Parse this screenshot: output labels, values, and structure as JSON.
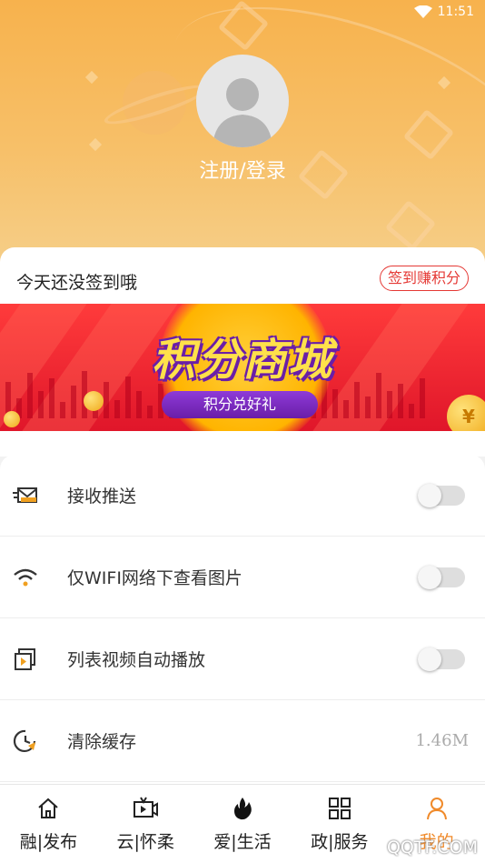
{
  "status_bar": {
    "time": "11:51"
  },
  "profile": {
    "login_label": "注册/登录"
  },
  "signin": {
    "prompt": "今天还没签到哦",
    "button_label": "签到赚积分"
  },
  "banner": {
    "title": "积分商城",
    "subtitle": "积分兑好礼",
    "coin_symbol": "¥"
  },
  "settings": {
    "items": [
      {
        "label": "接收推送",
        "icon": "mail-icon",
        "toggle_on": false
      },
      {
        "label": "仅WIFI网络下查看图片",
        "icon": "wifi-icon",
        "toggle_on": false
      },
      {
        "label": "列表视频自动播放",
        "icon": "video-play-icon",
        "toggle_on": false
      },
      {
        "label": "清除缓存",
        "icon": "clock-icon",
        "value": "1.46M"
      }
    ]
  },
  "tabbar": {
    "tabs": [
      {
        "label": "融|发布",
        "icon": "home-icon"
      },
      {
        "label": "云|怀柔",
        "icon": "tv-icon"
      },
      {
        "label": "爱|生活",
        "icon": "flame-icon"
      },
      {
        "label": "政|服务",
        "icon": "grid-icon"
      },
      {
        "label": "我的",
        "icon": "user-icon",
        "active": true
      }
    ]
  },
  "watermark": "QQTF.COM",
  "colors": {
    "header": "#f7b24d",
    "accent": "#f08a2a",
    "signin_red": "#e53935"
  }
}
